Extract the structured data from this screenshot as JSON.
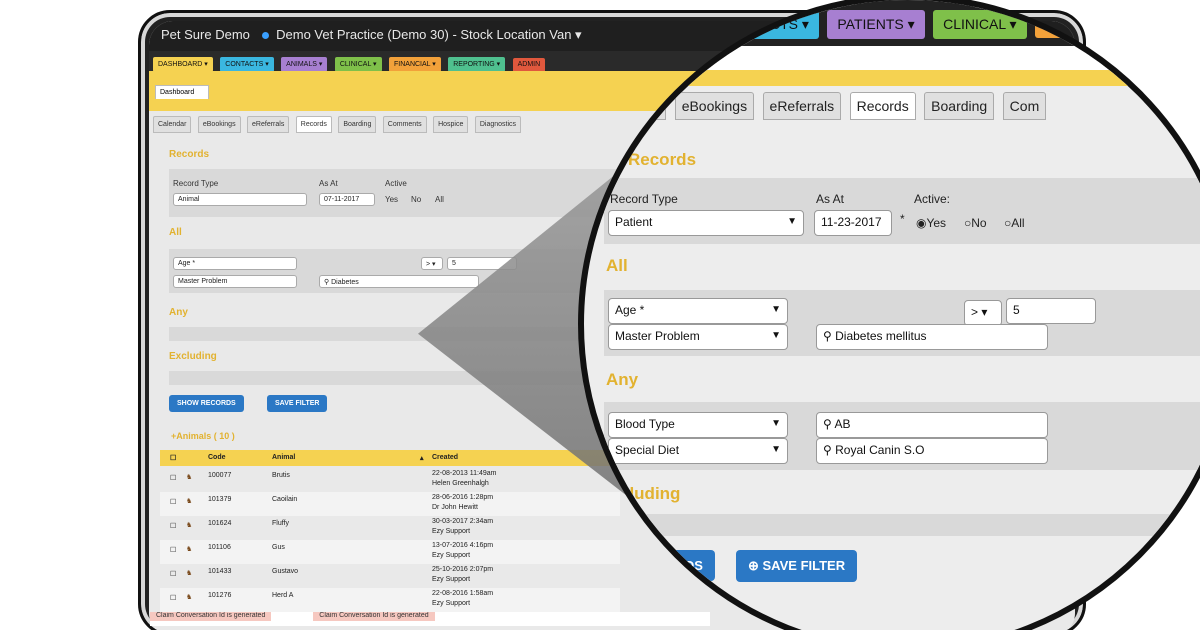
{
  "titlebar": {
    "app": "Pet Sure Demo",
    "practice": "Demo Vet Practice (Demo 30)",
    "location": "- Stock Location Van ▾"
  },
  "modules": [
    {
      "label": "DASHBOARD ▾",
      "color": "#f5d251"
    },
    {
      "label": "CONTACTS ▾",
      "color": "#3ab7e0"
    },
    {
      "label": "ANIMALS ▾",
      "color": "#a77fd1"
    },
    {
      "label": "CLINICAL ▾",
      "color": "#7fc04a"
    },
    {
      "label": "FINANCIAL ▾",
      "color": "#f2a13a"
    },
    {
      "label": "REPORTING ▾",
      "color": "#4fc08f"
    },
    {
      "label": "ADMIN",
      "color": "#e0583d"
    }
  ],
  "dash_tab": "Dashboard",
  "subtabs": [
    "Calendar",
    "eBookings",
    "eReferrals",
    "Records",
    "Boarding",
    "Comments",
    "Hospice",
    "Diagnostics"
  ],
  "filter": {
    "section_records": "Records",
    "record_type_label": "Record Type",
    "record_type_value": "Animal",
    "as_at_label": "As At",
    "as_at_value": "07-11-2017",
    "active_label": "Active",
    "active_opts": [
      "Yes",
      "No",
      "All"
    ],
    "all_label": "All",
    "age_field": "Age *",
    "age_op": "> ▾",
    "age_value": "5",
    "master_problem": "Master Problem",
    "master_value": "Diabetes",
    "any_label": "Any",
    "excluding_label": "Excluding",
    "show_btn": "SHOW RECORDS",
    "save_btn": "SAVE FILTER"
  },
  "animals_header": "Animals ( 10 )",
  "table": {
    "cols": [
      "Code",
      "Animal",
      "Created"
    ],
    "rows": [
      {
        "code": "100077",
        "animal": "Brutis",
        "created": "22-08-2013 11:49am",
        "by": "Helen Greenhalgh"
      },
      {
        "code": "101379",
        "animal": "Caoilain",
        "created": "28-06-2016 1:28pm",
        "by": "Dr John Hewitt"
      },
      {
        "code": "101624",
        "animal": "Fluffy",
        "created": "30-03-2017 2:34am",
        "by": "Ezy Support"
      },
      {
        "code": "101106",
        "animal": "Gus",
        "created": "13-07-2016 4:16pm",
        "by": "Ezy Support"
      },
      {
        "code": "101433",
        "animal": "Gustavo",
        "created": "25-10-2016 2:07pm",
        "by": "Ezy Support"
      },
      {
        "code": "101276",
        "animal": "Herd A",
        "created": "22-08-2016 1:58am",
        "by": "Ezy Support"
      }
    ]
  },
  "bottom": {
    "msg1": "Claim Conversation Id is generated",
    "msg2": "Claim Conversation Id is generated"
  },
  "lens": {
    "modules": [
      {
        "label": "CONTACTS ▾",
        "color": "#3ab7e0"
      },
      {
        "label": "PATIENTS ▾",
        "color": "#a77fd1"
      },
      {
        "label": "CLINICAL ▾",
        "color": "#7fc04a"
      },
      {
        "label": "",
        "color": "#f2a13a"
      }
    ],
    "subtabs": [
      "dar",
      "eBookings",
      "eReferrals",
      "Records",
      "Boarding",
      "Com"
    ],
    "records": "Records",
    "record_type_label": "Record Type",
    "record_type_value": "Patient",
    "as_at_label": "As At",
    "as_at_value": "11-23-2017",
    "active_label": "Active:",
    "active_opts": [
      "Yes",
      "No",
      "All"
    ],
    "all_label": "All",
    "age_field": "Age *",
    "age_op": "> ▾",
    "age_value": "5",
    "master_problem": "Master Problem",
    "master_value": "Diabetes mellitus",
    "any_label": "Any",
    "blood_type": "Blood Type",
    "blood_value": "AB",
    "special_diet": "Special Diet",
    "diet_value": "Royal Canin S.O",
    "excluding_label": "cluding",
    "show_btn": "CORDS",
    "save_btn": "SAVE FILTER"
  }
}
